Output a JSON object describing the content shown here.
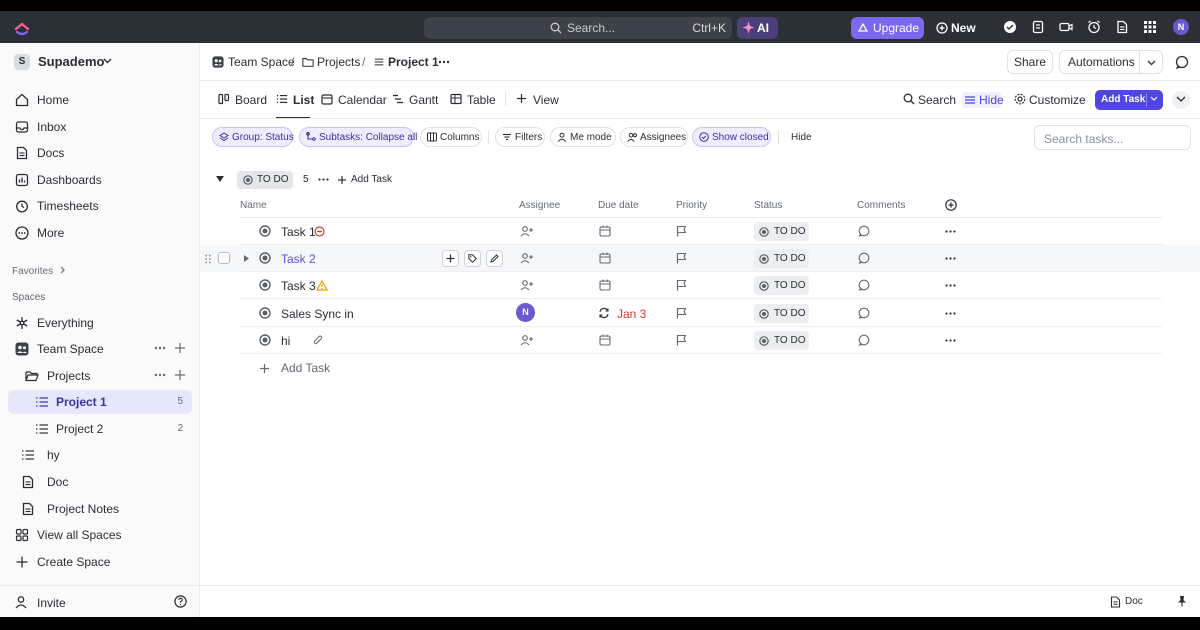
{
  "topbar": {
    "search_placeholder": "Search...",
    "search_shortcut": "Ctrl+K",
    "ai_label": "AI",
    "upgrade_label": "Upgrade",
    "new_label": "New",
    "user_initial": "N",
    "accent_color": "#7b68ee"
  },
  "sidebar": {
    "workspace_initial": "S",
    "workspace_name": "Supademo",
    "nav": [
      {
        "label": "Home",
        "icon": "home-icon"
      },
      {
        "label": "Inbox",
        "icon": "inbox-icon"
      },
      {
        "label": "Docs",
        "icon": "docs-icon"
      },
      {
        "label": "Dashboards",
        "icon": "dashboard-icon"
      },
      {
        "label": "Timesheets",
        "icon": "timer-icon"
      },
      {
        "label": "More",
        "icon": "more-icon"
      }
    ],
    "favorites_label": "Favorites",
    "spaces_label": "Spaces",
    "spaces": [
      {
        "label": "Everything"
      },
      {
        "label": "Team Space"
      },
      {
        "label": "Projects"
      },
      {
        "label": "Project 1",
        "count": "5"
      },
      {
        "label": "Project 2",
        "count": "2"
      },
      {
        "label": "hy"
      },
      {
        "label": "Doc"
      },
      {
        "label": "Project Notes"
      },
      {
        "label": "View all Spaces"
      },
      {
        "label": "Create Space"
      }
    ],
    "invite_label": "Invite"
  },
  "breadcrumb": {
    "items": [
      "Team Space",
      "Projects",
      "Project 1"
    ],
    "separator": "/"
  },
  "header": {
    "share_label": "Share",
    "automations_label": "Automations"
  },
  "views": {
    "items": [
      "Board",
      "List",
      "Calendar",
      "Gantt",
      "Table"
    ],
    "add_view": "View",
    "active": "List",
    "search_label": "Search",
    "hide_label": "Hide",
    "customize_label": "Customize",
    "add_task_label": "Add Task"
  },
  "filters": {
    "group_by": "Group: Status",
    "subtasks": "Subtasks: Collapse all",
    "columns": "Columns",
    "filters": "Filters",
    "me_mode": "Me mode",
    "assignees": "Assignees",
    "show_closed": "Show closed",
    "hide": "Hide",
    "search_placeholder": "Search tasks..."
  },
  "group": {
    "status": "TO DO",
    "count": "5",
    "add_task": "Add Task"
  },
  "columns": [
    "Name",
    "Assignee",
    "Due date",
    "Priority",
    "Status",
    "Comments"
  ],
  "tasks": [
    {
      "name": "Task 1",
      "status": "TO DO",
      "badge": "blocked"
    },
    {
      "name": "Task 2",
      "status": "TO DO",
      "badge": ""
    },
    {
      "name": "Task 3",
      "status": "TO DO",
      "badge": "warning"
    },
    {
      "name": "Sales Sync in",
      "status": "TO DO",
      "assignee": "N",
      "due": "Jan 3"
    },
    {
      "name": "hi",
      "status": "TO DO",
      "badge": "attachment"
    }
  ],
  "add_task_row": "Add Task",
  "bottom": {
    "doc_label": "Doc"
  }
}
